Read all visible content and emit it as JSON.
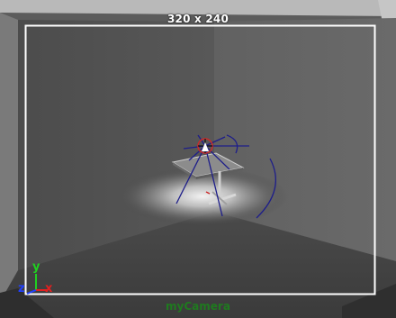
{
  "viewport": {
    "resolution_label": "320 x 240",
    "camera_label": "myCamera",
    "camera_label_color": "#1f7a1f",
    "axes": {
      "x": "x",
      "y": "y",
      "z": "z"
    },
    "axis_colors": {
      "x": "#e02020",
      "y": "#20d020",
      "z": "#2040ff"
    },
    "colors": {
      "background": "#5e5e5e",
      "resolution_gate": "#ffffff",
      "rig_lines": "#1e1e8a",
      "light_marker": "#cc2a2a"
    },
    "icons": [
      "perspective-grid-icon",
      "spotlight-icon",
      "table-model-icon",
      "axis-gizmo-icon"
    ]
  }
}
